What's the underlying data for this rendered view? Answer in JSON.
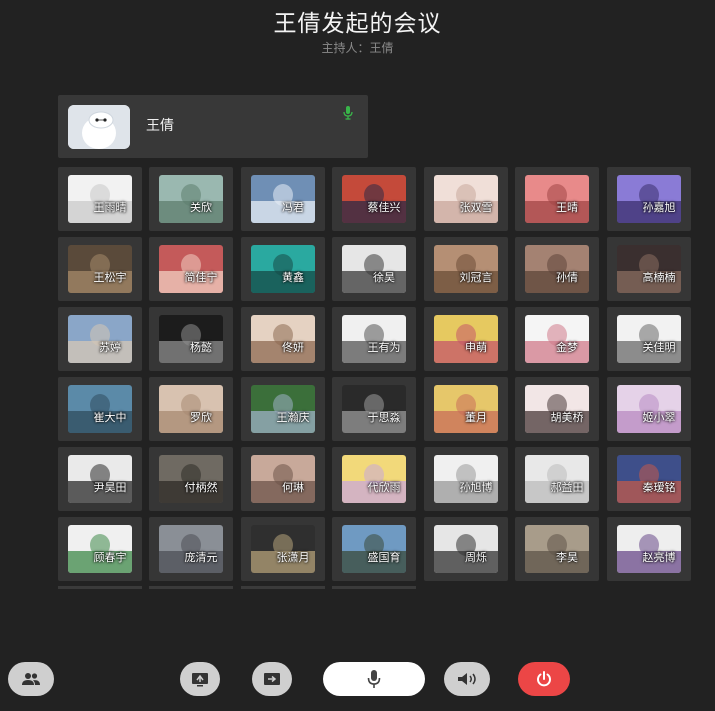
{
  "meeting": {
    "title": "王倩发起的会议",
    "host_line": "主持人：王倩"
  },
  "host": {
    "name": "王倩",
    "mic_color": "#39b54a"
  },
  "participants": [
    {
      "name": "王雨晴",
      "c1": "#f2f2f2",
      "c2": "#c9c9c9"
    },
    {
      "name": "关欣",
      "c1": "#9ab8b0",
      "c2": "#5d7d6e"
    },
    {
      "name": "冯君",
      "c1": "#6f8fb5",
      "c2": "#e7eef5"
    },
    {
      "name": "蔡佳兴",
      "c1": "#c44a3a",
      "c2": "#2d2a45"
    },
    {
      "name": "张双雪",
      "c1": "#f0dfd8",
      "c2": "#c9a79c"
    },
    {
      "name": "王晴",
      "c1": "#e88a8a",
      "c2": "#a14646"
    },
    {
      "name": "孙嘉旭",
      "c1": "#8a7bd6",
      "c2": "#3b2f6e"
    },
    {
      "name": "王松宇",
      "c1": "#5a4a3a",
      "c2": "#a58a6a"
    },
    {
      "name": "简佳宁",
      "c1": "#c45a5a",
      "c2": "#f2cfc2"
    },
    {
      "name": "黄鑫",
      "c1": "#2aa9a0",
      "c2": "#154b47"
    },
    {
      "name": "徐昊",
      "c1": "#e6e6e6",
      "c2": "#3a3a3a"
    },
    {
      "name": "刘冠言",
      "c1": "#b58f74",
      "c2": "#6b4d37"
    },
    {
      "name": "孙倩",
      "c1": "#a48272",
      "c2": "#5e463a"
    },
    {
      "name": "高楠楠",
      "c1": "#3a2f2f",
      "c2": "#8a6d60"
    },
    {
      "name": "苏婷",
      "c1": "#8aa6c8",
      "c2": "#d6c7b5"
    },
    {
      "name": "杨懿",
      "c1": "#1c1c1c",
      "c2": "#8e8e8e"
    },
    {
      "name": "佟妍",
      "c1": "#e5d2c2",
      "c2": "#8d6a52"
    },
    {
      "name": "王有为",
      "c1": "#f0f0f0",
      "c2": "#555555"
    },
    {
      "name": "申萌",
      "c1": "#e6c960",
      "c2": "#c4566a"
    },
    {
      "name": "金梦",
      "c1": "#f5f5f5",
      "c2": "#d07a8a"
    },
    {
      "name": "关佳明",
      "c1": "#f2f2f2",
      "c2": "#6a6a6a"
    },
    {
      "name": "崔大中",
      "c1": "#5b8aa8",
      "c2": "#2f4c5e"
    },
    {
      "name": "罗欣",
      "c1": "#d8c2b0",
      "c2": "#a88a72"
    },
    {
      "name": "王瀚庆",
      "c1": "#3b6f3a",
      "c2": "#9fb0c7"
    },
    {
      "name": "于思淼",
      "c1": "#2a2a2a",
      "c2": "#9a9a9a"
    },
    {
      "name": "董月",
      "c1": "#e6c76a",
      "c2": "#c86e5a"
    },
    {
      "name": "胡美桥",
      "c1": "#f2e6e6",
      "c2": "#4a3a3a"
    },
    {
      "name": "姬小翠",
      "c1": "#e5d2e8",
      "c2": "#b88ac2"
    },
    {
      "name": "尹昊田",
      "c1": "#eaeaea",
      "c2": "#2b2b2b"
    },
    {
      "name": "付柄然",
      "c1": "#6f6a62",
      "c2": "#2e2b27"
    },
    {
      "name": "何琳",
      "c1": "#c8a99a",
      "c2": "#6d5449"
    },
    {
      "name": "代欣雨",
      "c1": "#f2d97a",
      "c2": "#c9a7d9"
    },
    {
      "name": "孙旭博",
      "c1": "#f0f0f0",
      "c2": "#9a9a9a"
    },
    {
      "name": "郝益田",
      "c1": "#e8e8e8",
      "c2": "#bcbcbc"
    },
    {
      "name": "秦瑷铭",
      "c1": "#3e4f8a",
      "c2": "#c25a4a"
    },
    {
      "name": "顾春宇",
      "c1": "#f0f0f0",
      "c2": "#3f8a4a"
    },
    {
      "name": "庞清元",
      "c1": "#8a8f96",
      "c2": "#4c4f55"
    },
    {
      "name": "张潇月",
      "c1": "#2f2f2f",
      "c2": "#b5a27a"
    },
    {
      "name": "盛国育",
      "c1": "#6f9ac2",
      "c2": "#3a4a3a"
    },
    {
      "name": "周烁",
      "c1": "#e6e6e6",
      "c2": "#333333"
    },
    {
      "name": "李昊",
      "c1": "#a89c8a",
      "c2": "#5e5448"
    },
    {
      "name": "赵亮博",
      "c1": "#eeeeee",
      "c2": "#6a4a8a"
    }
  ],
  "toolbar": {
    "participants_icon": "people-icon",
    "share_icon": "share-screen-icon",
    "share2_icon": "screen-cast-icon",
    "mic_icon": "microphone-icon",
    "speaker_icon": "speaker-icon",
    "leave_icon": "power-icon",
    "leave_color": "#ec4646"
  }
}
